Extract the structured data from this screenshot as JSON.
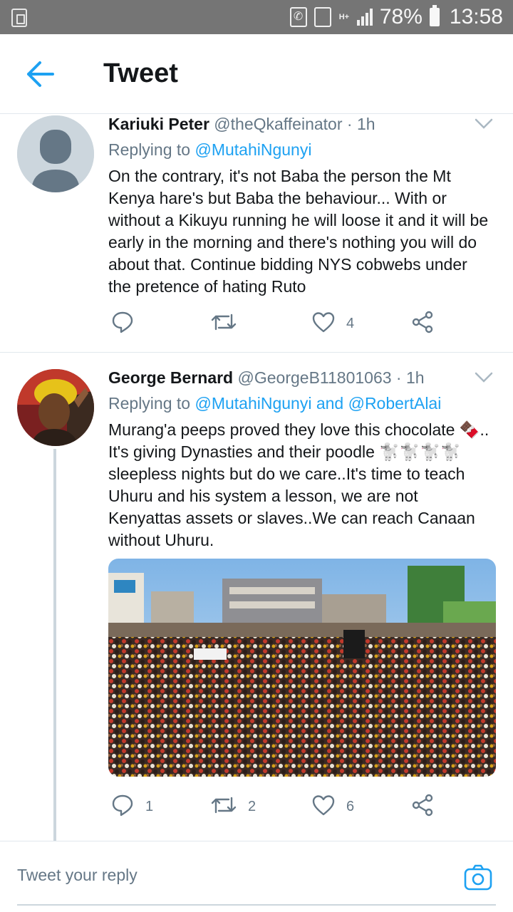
{
  "status_bar": {
    "battery_percent": "78%",
    "time": "13:58",
    "network": "H+"
  },
  "header": {
    "title": "Tweet"
  },
  "tweets": [
    {
      "name": "Kariuki Peter",
      "handle": "@theQkaffeinator",
      "time": "· 1h",
      "replying_prefix": "Replying to",
      "replying_to": "@MutahiNgunyi",
      "text": "On the contrary, it's not Baba the person the Mt Kenya hare's but Baba the behaviour... With or without a Kikuyu running he will loose it and it will be early in the morning and there's nothing you will do about that. Continue bidding NYS cobwebs under the pretence of hating Ruto",
      "replies": "",
      "retweets": "",
      "likes": "4"
    },
    {
      "name": "George Bernard",
      "handle": "@GeorgeB11801063",
      "time": "· 1h",
      "replying_prefix": "Replying to",
      "replying_to": "@MutahiNgunyi and @RobertAlai",
      "text": "Murang'a peeps proved they love this chocolate 🍫.. It's giving Dynasties and their poodle 🐩🐩🐩🐩 sleepless nights but do we care..It's time to teach Uhuru and his system a lesson, we are not Kenyattas assets or slaves..We can reach Canaan without Uhuru.",
      "replies": "1",
      "retweets": "2",
      "likes": "6"
    }
  ],
  "reply_bar": {
    "placeholder": "Tweet your reply"
  },
  "colors": {
    "accent": "#1da1f2",
    "secondary_text": "#657786",
    "status_bar": "#757575"
  }
}
